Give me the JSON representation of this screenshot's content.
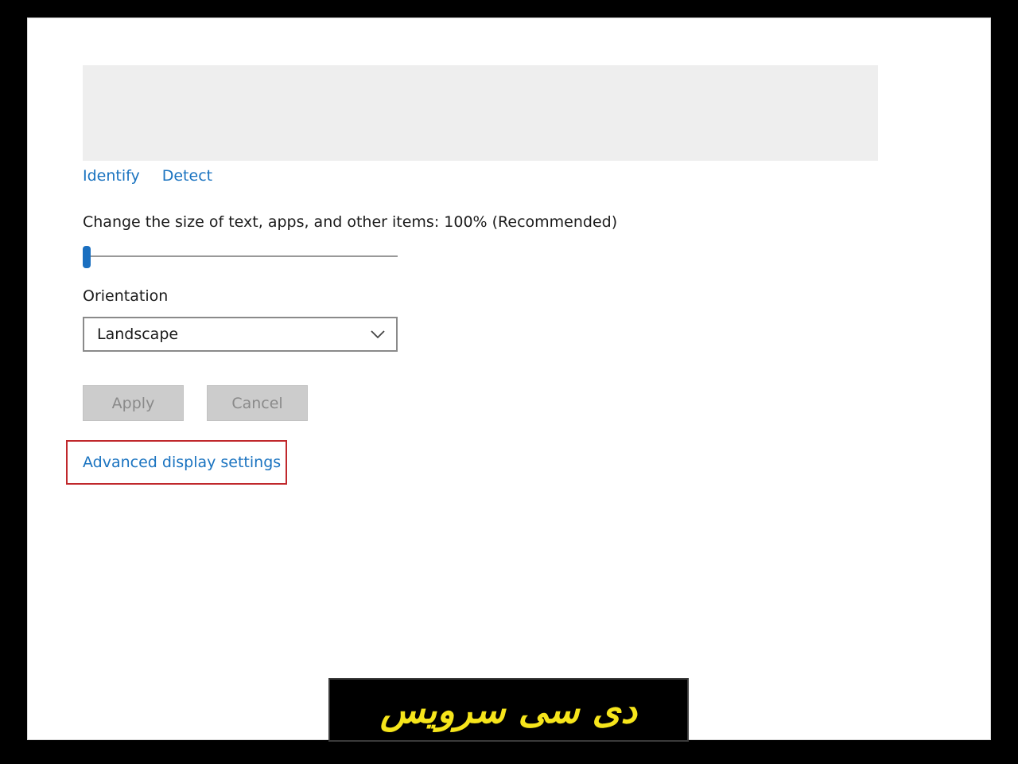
{
  "display": {
    "links": {
      "identify": "Identify",
      "detect": "Detect"
    },
    "scale": {
      "label": "Change the size of text, apps, and other items: 100% (Recommended)",
      "slider_position": 0
    },
    "orientation": {
      "label": "Orientation",
      "selected": "Landscape"
    },
    "buttons": {
      "apply": "Apply",
      "cancel": "Cancel"
    },
    "advanced_link": "Advanced display settings"
  },
  "watermark": {
    "text": "دی سی سرویس"
  },
  "colors": {
    "link": "#1a73c0",
    "highlight_border": "#c0282c",
    "slider_thumb": "#1a6fc0",
    "watermark_text": "#f6e51b"
  },
  "icons": {
    "dropdown": "chevron-down-icon"
  }
}
